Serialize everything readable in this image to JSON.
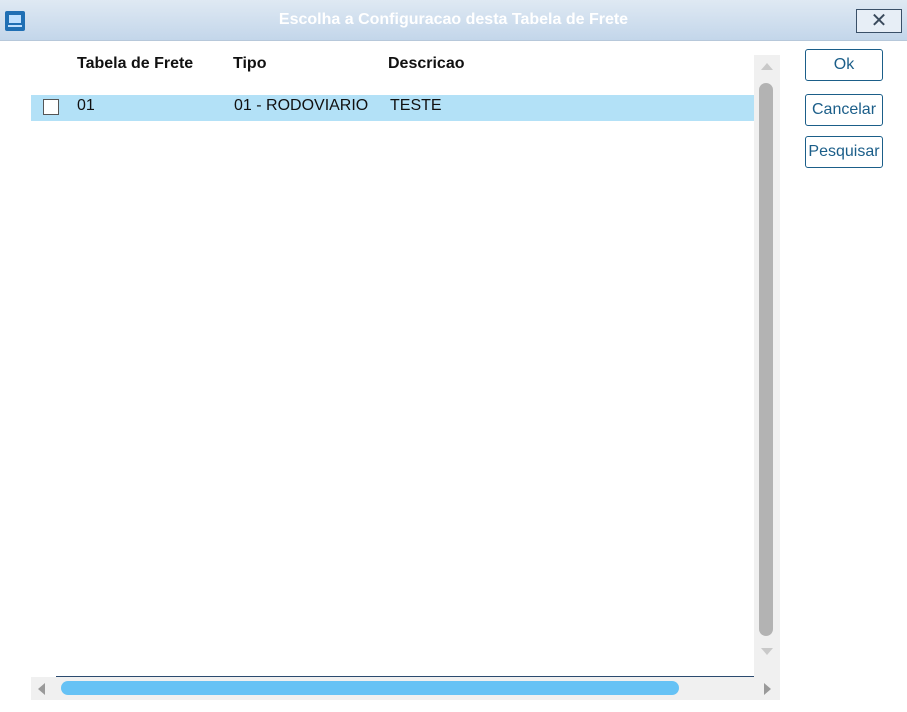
{
  "window": {
    "title": "Escolha a Configuracao desta Tabela de Frete",
    "close_label": "✕"
  },
  "grid": {
    "columns": [
      "Tabela de Frete",
      "Tipo",
      "Descricao"
    ],
    "rows": [
      {
        "checked": false,
        "tabela": "01",
        "tipo": "01 - RODOVIARIO",
        "descricao": "TESTE"
      }
    ]
  },
  "buttons": {
    "ok": "Ok",
    "cancel": "Cancelar",
    "search": "Pesquisar"
  },
  "colors": {
    "selected_row": "#b3e1f7",
    "button_accent": "#1b5e89",
    "hscroll_thumb": "#66c2f5",
    "vscroll_thumb": "#b3b3b3"
  },
  "icons": {
    "app": "app-window-icon",
    "close": "close-icon"
  }
}
